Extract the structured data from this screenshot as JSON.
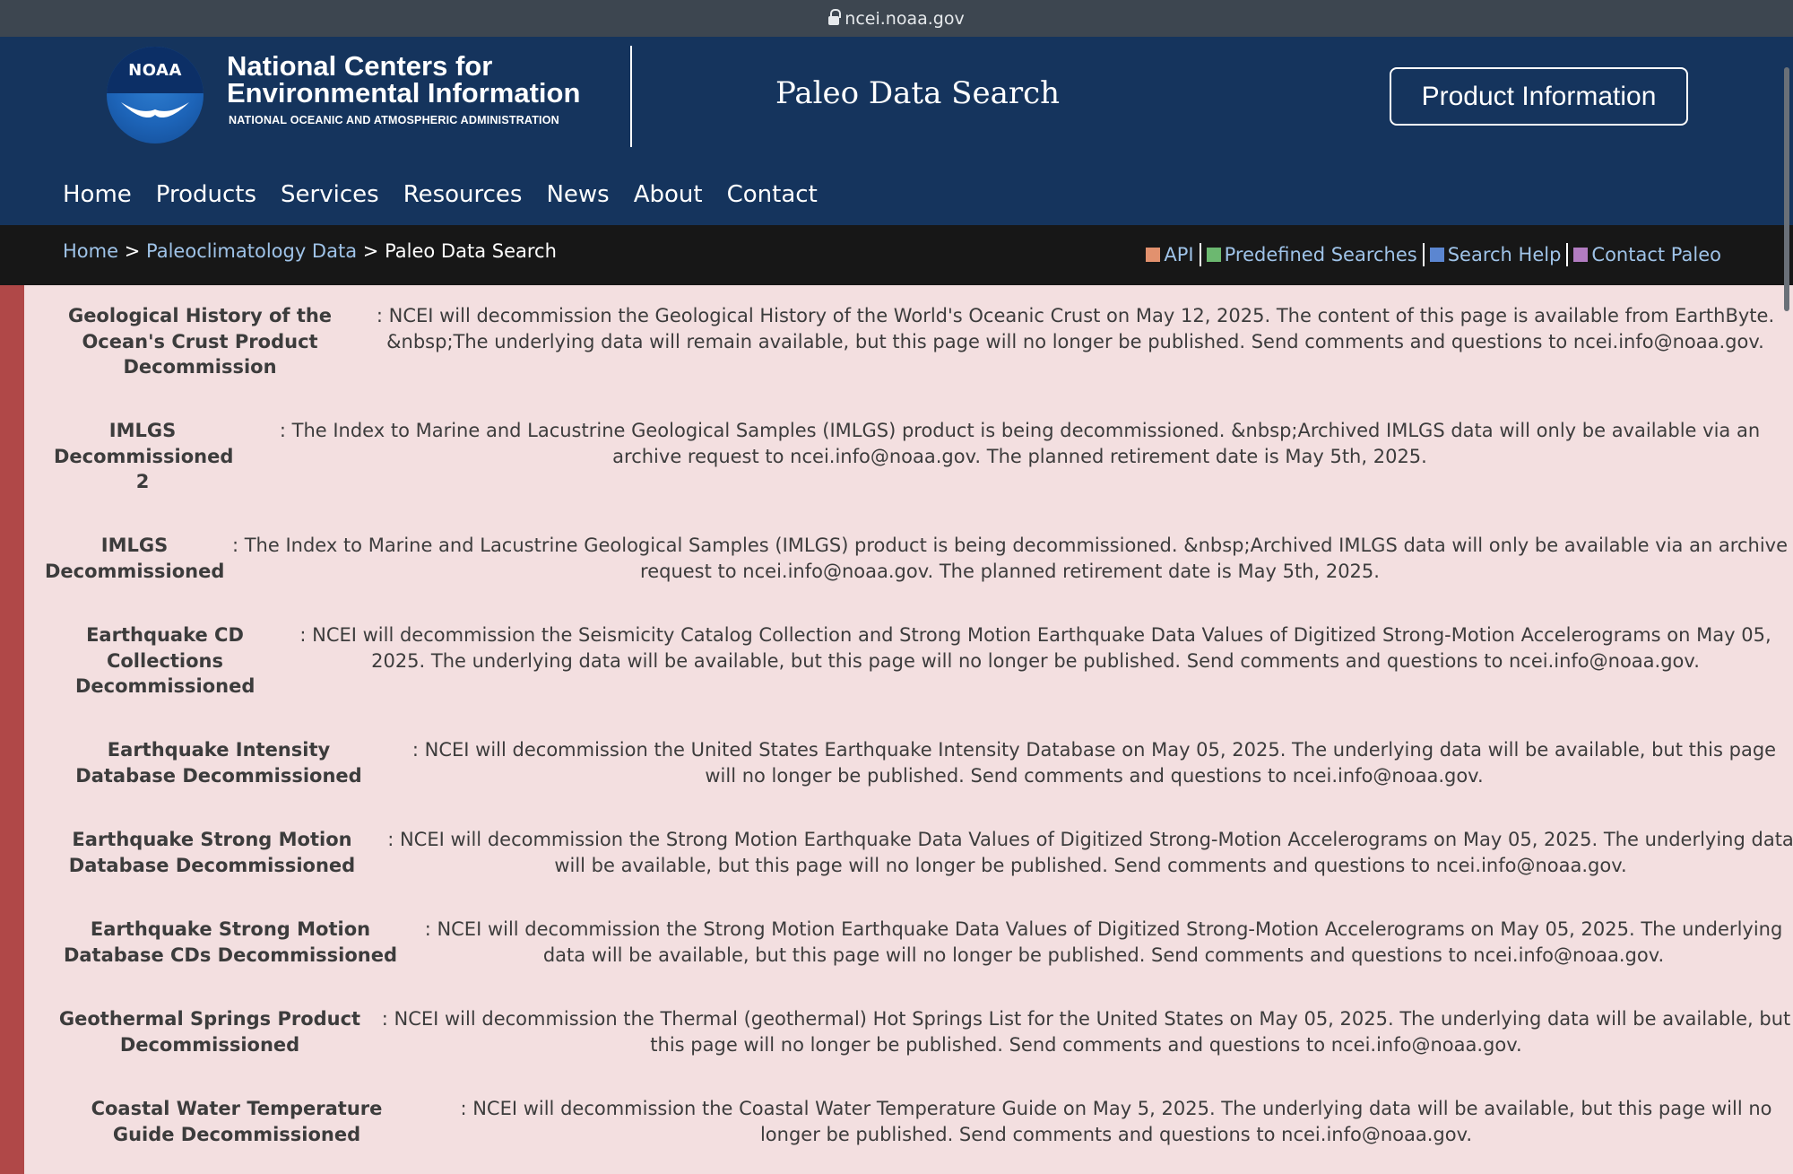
{
  "browser": {
    "url": "ncei.noaa.gov"
  },
  "header": {
    "logo_text": "NOAA",
    "org_line1": "National Centers for",
    "org_line2": "Environmental Information",
    "org_sub": "NATIONAL OCEANIC AND ATMOSPHERIC ADMINISTRATION",
    "site_title": "Paleo Data Search",
    "product_button": "Product Information"
  },
  "nav": [
    "Home",
    "Products",
    "Services",
    "Resources",
    "News",
    "About",
    "Contact"
  ],
  "breadcrumb": {
    "home": "Home",
    "sep1": ">",
    "section": "Paleoclimatology Data",
    "sep2": ">",
    "current": "Paleo Data Search"
  },
  "quicklinks": [
    {
      "label": "API",
      "color": "#e2916e"
    },
    {
      "label": "Predefined Searches",
      "color": "#6cb870"
    },
    {
      "label": "Search Help",
      "color": "#5b86d1"
    },
    {
      "label": "Contact Paleo",
      "color": "#b27cc1"
    }
  ],
  "colors": {
    "header_bg": "#15345d",
    "crumb_bg": "#171717",
    "content_bg": "#f3dfe0",
    "accent_bar": "#b04848",
    "link": "#9fc3e8"
  },
  "notices": [
    {
      "title": "Geological History of the Ocean's Crust Product Decommission",
      "body": ": NCEI will decommission the Geological History of the World's Oceanic Crust on May 12, 2025. The content of this page is available from EarthByte. &nbsp;The underlying data will remain available, but this page will no longer be published. Send comments and questions to ncei.info@noaa.gov."
    },
    {
      "title": "IMLGS Decommissioned 2",
      "body": ": The Index to Marine and Lacustrine Geological Samples (IMLGS) product is being decommissioned. &nbsp;Archived IMLGS data will only be available via an archive request to ncei.info@noaa.gov. The planned retirement date is May 5th, 2025."
    },
    {
      "title": "IMLGS Decommissioned",
      "body": ": The Index to Marine and Lacustrine Geological Samples (IMLGS) product is being decommissioned. &nbsp;Archived IMLGS data will only be available via an archive request to ncei.info@noaa.gov. The planned retirement date is May 5th, 2025."
    },
    {
      "title": "Earthquake CD Collections Decommissioned",
      "body": ": NCEI will decommission the Seismicity Catalog Collection and Strong Motion Earthquake Data Values of Digitized Strong-Motion Accelerograms on May 05, 2025. The underlying data will be available, but this page will no longer be published. Send comments and questions to ncei.info@noaa.gov."
    },
    {
      "title": "Earthquake Intensity Database Decommissioned",
      "body": ": NCEI will decommission the United States Earthquake Intensity Database on May 05, 2025. The underlying data will be available, but this page will no longer be published. Send comments and questions to ncei.info@noaa.gov."
    },
    {
      "title": "Earthquake Strong Motion Database Decommissioned",
      "body": ": NCEI will decommission the Strong Motion Earthquake Data Values of Digitized Strong-Motion Accelerograms on May 05, 2025. The underlying data will be available, but this page will no longer be published. Send comments and questions to ncei.info@noaa.gov."
    },
    {
      "title": "Earthquake Strong Motion Database CDs Decommissioned",
      "body": ": NCEI will decommission the Strong Motion Earthquake Data Values of Digitized Strong-Motion Accelerograms on May 05, 2025. The underlying data will be available, but this page will no longer be published. Send comments and questions to ncei.info@noaa.gov."
    },
    {
      "title": "Geothermal Springs Product Decommissioned",
      "body": ": NCEI will decommission the Thermal (geothermal) Hot Springs List for the United States on May 05, 2025. The underlying data will be available, but this page will no longer be published. Send comments and questions to ncei.info@noaa.gov."
    },
    {
      "title": "Coastal Water Temperature Guide Decommissioned",
      "body": ": NCEI will decommission the Coastal Water Temperature Guide on May 5, 2025. The underlying data will be available, but this page will no longer be published. Send comments and questions to ncei.info@noaa.gov."
    }
  ]
}
